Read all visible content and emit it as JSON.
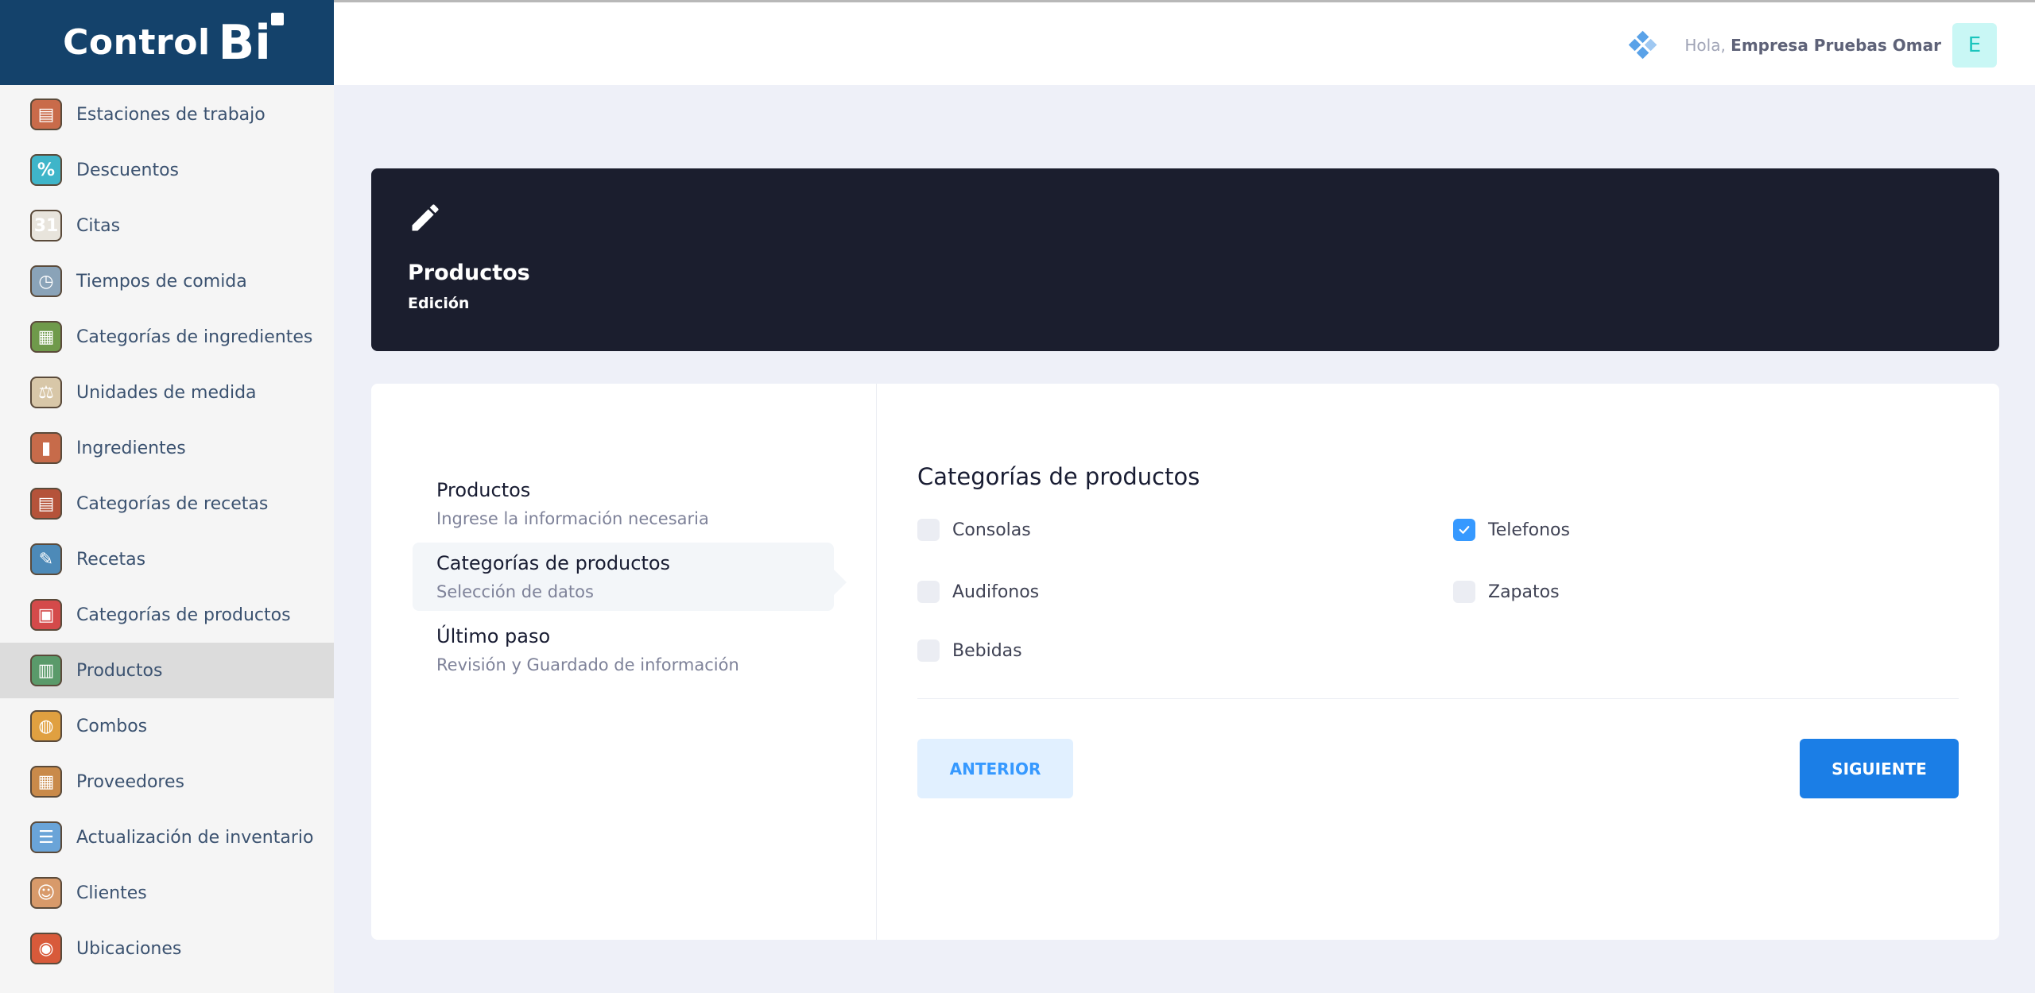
{
  "brand": {
    "word": "Control",
    "bi": "Bi"
  },
  "sidebar": {
    "items": [
      {
        "label": "Estaciones de trabajo",
        "icon": "workstation-icon",
        "color": "#c96b4a",
        "glyph": "▤"
      },
      {
        "label": "Descuentos",
        "icon": "discount-icon",
        "color": "#3fb5c9",
        "glyph": "%"
      },
      {
        "label": "Citas",
        "icon": "calendar-icon",
        "color": "#e8e4dc",
        "glyph": "31"
      },
      {
        "label": "Tiempos de comida",
        "icon": "meal-time-icon",
        "color": "#8aa3b8",
        "glyph": "◷"
      },
      {
        "label": "Categorías de ingredientes",
        "icon": "ingredient-category-icon",
        "color": "#6f9a4b",
        "glyph": "▦"
      },
      {
        "label": "Unidades de medida",
        "icon": "measure-icon",
        "color": "#d8c7a8",
        "glyph": "⚖"
      },
      {
        "label": "Ingredientes",
        "icon": "ingredients-icon",
        "color": "#c76b4a",
        "glyph": "▮"
      },
      {
        "label": "Categorías de recetas",
        "icon": "recipe-category-icon",
        "color": "#b5533a",
        "glyph": "▤"
      },
      {
        "label": "Recetas",
        "icon": "recipe-icon",
        "color": "#4d8ab8",
        "glyph": "✎"
      },
      {
        "label": "Categorías de productos",
        "icon": "product-category-icon",
        "color": "#d44a4a",
        "glyph": "▣"
      },
      {
        "label": "Productos",
        "icon": "products-icon",
        "color": "#5a9a6a",
        "glyph": "▥"
      },
      {
        "label": "Combos",
        "icon": "combo-icon",
        "color": "#e0a040",
        "glyph": "◍"
      },
      {
        "label": "Proveedores",
        "icon": "supplier-icon",
        "color": "#c98a4a",
        "glyph": "▦"
      },
      {
        "label": "Actualización de inventario",
        "icon": "inventory-icon",
        "color": "#6aa4d8",
        "glyph": "☰"
      },
      {
        "label": "Clientes",
        "icon": "clients-icon",
        "color": "#d89a6a",
        "glyph": "☺"
      },
      {
        "label": "Ubicaciones",
        "icon": "location-icon",
        "color": "#d85a3a",
        "glyph": "◉"
      }
    ],
    "active_index": 10
  },
  "header": {
    "greeting": "Hola,",
    "user": "Empresa Pruebas Omar",
    "avatar_letter": "E"
  },
  "banner": {
    "title": "Productos",
    "subtitle": "Edición"
  },
  "steps": [
    {
      "title": "Productos",
      "desc": "Ingrese la información necesaria"
    },
    {
      "title": "Categorías de productos",
      "desc": "Selección de datos"
    },
    {
      "title": "Último paso",
      "desc": "Revisión y Guardado de información"
    }
  ],
  "form": {
    "title": "Categorías de productos",
    "categories": [
      {
        "label": "Consolas",
        "checked": false
      },
      {
        "label": "Telefonos",
        "checked": true
      },
      {
        "label": "Audifonos",
        "checked": false
      },
      {
        "label": "Zapatos",
        "checked": false
      },
      {
        "label": "Bebidas",
        "checked": false
      }
    ],
    "prev_label": "ANTERIOR",
    "next_label": "SIGUIENTE"
  },
  "colors": {
    "accent": "#3699ff",
    "primary_button": "#1b7ee6",
    "brand": "#14426b",
    "banner": "#1b1e2e"
  }
}
